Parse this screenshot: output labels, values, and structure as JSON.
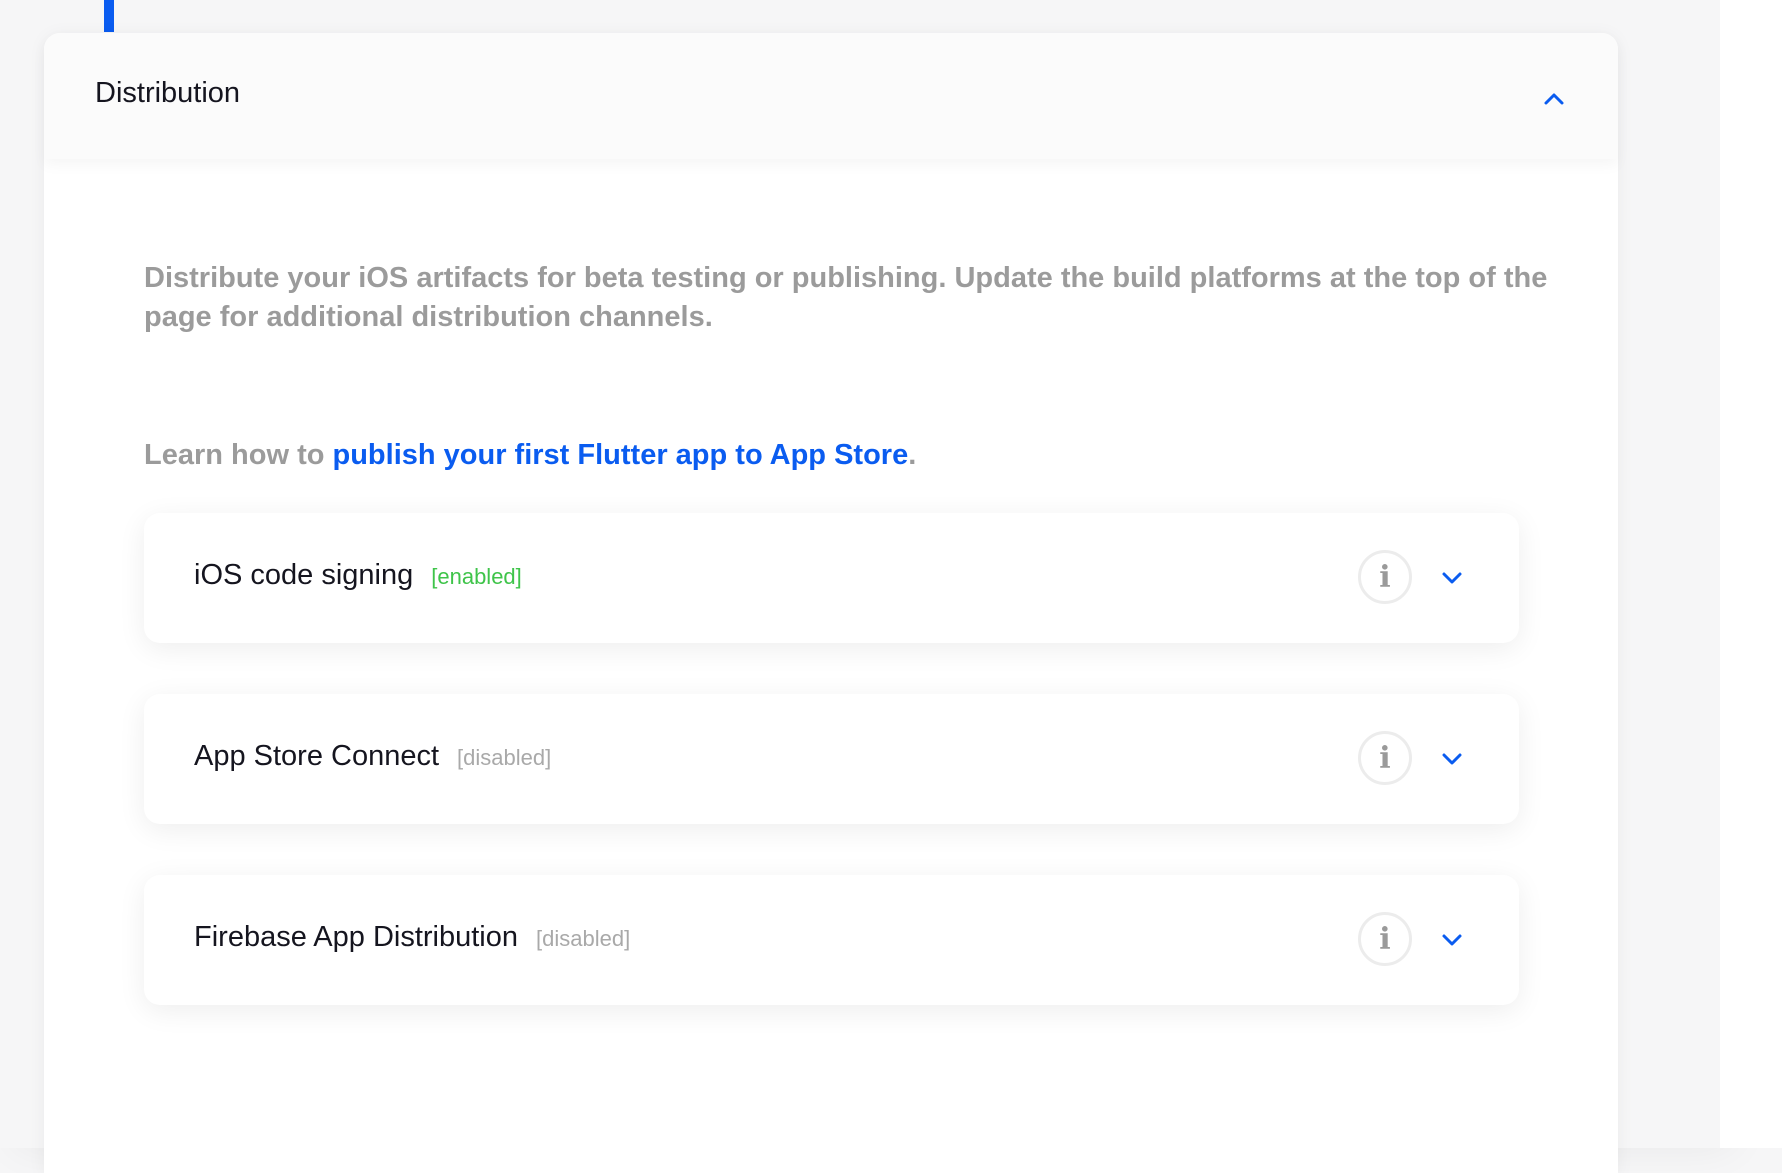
{
  "colors": {
    "accent": "#0a5cf0",
    "enabled": "#3fc44a",
    "disabled": "#a9a9a9",
    "muted_text": "#9b9b9b",
    "heading_text": "#15151f"
  },
  "section": {
    "title": "Distribution",
    "collapse_icon": "chevron-up-icon"
  },
  "description": "Distribute your iOS artifacts for beta testing or publishing. Update the build platforms at the top of the page for additional distribution channels.",
  "learn": {
    "prefix": "Learn how to ",
    "link_text": "publish your first Flutter app to App Store",
    "suffix": "."
  },
  "cards": [
    {
      "title": "iOS code signing",
      "status": "[enabled]",
      "info_icon": "info-icon",
      "expand_icon": "chevron-down-icon"
    },
    {
      "title": "App Store Connect",
      "status": "[disabled]",
      "info_icon": "info-icon",
      "expand_icon": "chevron-down-icon"
    },
    {
      "title": "Firebase App Distribution",
      "status": "[disabled]",
      "info_icon": "info-icon",
      "expand_icon": "chevron-down-icon"
    }
  ]
}
